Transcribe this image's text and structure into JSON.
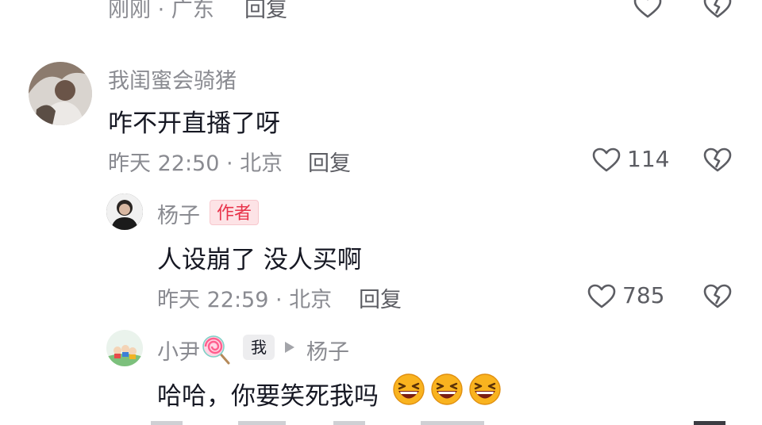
{
  "comments": [
    {
      "meta": "刚刚 · 广东",
      "reply_label": "回复",
      "likes": ""
    },
    {
      "username": "我闺蜜会骑猪",
      "text": "咋不开直播了呀",
      "meta": "昨天 22:50 · 北京",
      "reply_label": "回复",
      "likes": "114"
    },
    {
      "username": "杨子",
      "badge": "作者",
      "text": "人设崩了 没人买啊",
      "meta": "昨天 22:59 · 北京",
      "reply_label": "回复",
      "likes": "785"
    },
    {
      "username": "小尹",
      "badge_me": "我",
      "reply_to": "杨子",
      "text": "哈哈，你要笑死我吗",
      "emoji": [
        "laughing-emoji",
        "laughing-emoji",
        "laughing-emoji"
      ]
    }
  ],
  "icons": {
    "like": "heart-icon",
    "dislike": "broken-heart-icon",
    "reply_arrow": "play-arrow-icon",
    "lollipop": "lollipop-icon"
  },
  "colors": {
    "text_primary": "#161823",
    "text_secondary": "#8a8b91",
    "author_badge": "#e8334a",
    "author_badge_bg": "#fde3e6"
  }
}
